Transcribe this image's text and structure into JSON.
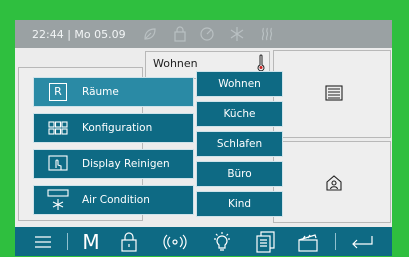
{
  "status_bar": {
    "clock": "22:44 | Mo 05.09",
    "icons": [
      "leaf-icon",
      "lock-icon",
      "heating-dial-icon",
      "snowflake-icon",
      "heat-waves-icon"
    ]
  },
  "room": {
    "name": "Wohnen",
    "thermometer_icon": "thermometer-icon",
    "tiles": [
      "blinds-icon",
      "home-presence-icon"
    ]
  },
  "menu": {
    "items": [
      {
        "label": "Räume",
        "icon": "rooms-r-icon",
        "icon_text": "R"
      },
      {
        "label": "Konfiguration",
        "icon": "grid-icon"
      },
      {
        "label": "Display Reinigen",
        "icon": "hand-touch-icon"
      },
      {
        "label": "Air Condition",
        "icon": "aircon-icon"
      }
    ]
  },
  "submenu": {
    "items": [
      "Wohnen",
      "Küche",
      "Schlafen",
      "Büro",
      "Kind"
    ]
  },
  "bottom_bar": {
    "menu_icon": "hamburger-icon",
    "m_label": "M",
    "icons": [
      "padlock-icon",
      "wireless-icon",
      "lightbulb-icon",
      "documents-icon",
      "clapperboard-icon",
      "return-icon"
    ]
  },
  "colors": {
    "frame": "#2fbf3f",
    "accent": "#0e6a84",
    "topbar": "#9aa1a3",
    "panel": "#ececec"
  }
}
